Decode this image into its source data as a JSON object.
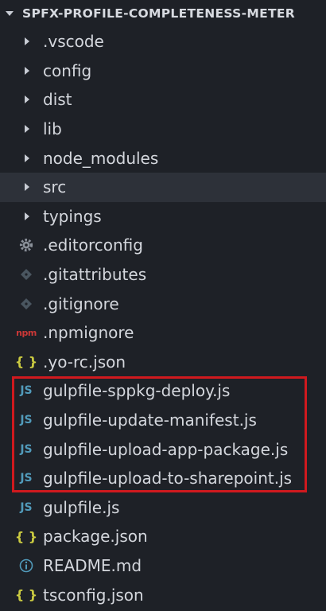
{
  "explorer": {
    "root_title": "SPFX-PROFILE-COMPLETENESS-METER",
    "highlight_color": "#d0191e",
    "folders": [
      {
        "label": ".vscode",
        "icon": "chevron-right-icon"
      },
      {
        "label": "config",
        "icon": "chevron-right-icon"
      },
      {
        "label": "dist",
        "icon": "chevron-right-icon"
      },
      {
        "label": "lib",
        "icon": "chevron-right-icon"
      },
      {
        "label": "node_modules",
        "icon": "chevron-right-icon"
      },
      {
        "label": "src",
        "icon": "chevron-right-icon",
        "selected": true
      },
      {
        "label": "typings",
        "icon": "chevron-right-icon"
      }
    ],
    "files": [
      {
        "label": ".editorconfig",
        "icon": "gear-icon",
        "glyph": "⚙"
      },
      {
        "label": ".gitattributes",
        "icon": "git-icon",
        "glyph": "◆"
      },
      {
        "label": ".gitignore",
        "icon": "git-icon",
        "glyph": "◆"
      },
      {
        "label": ".npmignore",
        "icon": "npm-icon",
        "glyph": "npm"
      },
      {
        "label": ".yo-rc.json",
        "icon": "json-icon",
        "glyph": "{ }"
      },
      {
        "label": "gulpfile-sppkg-deploy.js",
        "icon": "js-icon",
        "glyph": "JS"
      },
      {
        "label": "gulpfile-update-manifest.js",
        "icon": "js-icon",
        "glyph": "JS"
      },
      {
        "label": "gulpfile-upload-app-package.js",
        "icon": "js-icon",
        "glyph": "JS"
      },
      {
        "label": "gulpfile-upload-to-sharepoint.js",
        "icon": "js-icon",
        "glyph": "JS"
      },
      {
        "label": "gulpfile.js",
        "icon": "js-icon",
        "glyph": "JS"
      },
      {
        "label": "package.json",
        "icon": "json-icon",
        "glyph": "{ }"
      },
      {
        "label": "README.md",
        "icon": "info-icon",
        "glyph": "ⓘ"
      },
      {
        "label": "tsconfig.json",
        "icon": "json-icon",
        "glyph": "{ }"
      }
    ]
  }
}
